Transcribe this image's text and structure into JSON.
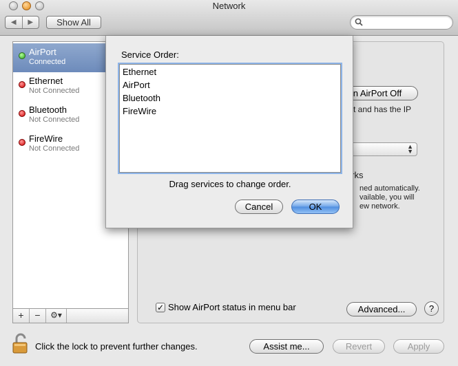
{
  "window": {
    "title": "Network"
  },
  "toolbar": {
    "back_glyph": "◀",
    "forward_glyph": "▶",
    "show_all_label": "Show All",
    "search_placeholder": ""
  },
  "sidebar": {
    "services": [
      {
        "name": "AirPort",
        "status": "Connected",
        "status_color": "green",
        "selected": true
      },
      {
        "name": "Ethernet",
        "status": "Not Connected",
        "status_color": "red",
        "selected": false
      },
      {
        "name": "Bluetooth",
        "status": "Not Connected",
        "status_color": "red",
        "selected": false
      },
      {
        "name": "FireWire",
        "status": "Not Connected",
        "status_color": "red",
        "selected": false
      }
    ],
    "add_label": "+",
    "remove_label": "−",
    "gear_label": "⚙▾"
  },
  "panel": {
    "turn_off_label": "n AirPort Off",
    "status_desc": "t and has the IP",
    "ask_networks_partial": "orks",
    "ask_desc_lines": [
      "ned automatically.",
      "vailable, you will",
      "ew network."
    ],
    "show_status_checked": true,
    "show_status_label": "Show AirPort status in menu bar",
    "advanced_label": "Advanced...",
    "help_label": "?"
  },
  "footer": {
    "lock_text": "Click the lock to prevent further changes.",
    "assist_label": "Assist me...",
    "revert_label": "Revert",
    "apply_label": "Apply"
  },
  "sheet": {
    "label": "Service Order:",
    "services": [
      "Ethernet",
      "AirPort",
      "Bluetooth",
      "FireWire"
    ],
    "hint": "Drag services to change order.",
    "cancel_label": "Cancel",
    "ok_label": "OK"
  },
  "colors": {
    "selection": "#7592c2",
    "default_button": "#5e98e4",
    "focus_ring": "#8db4e8"
  }
}
